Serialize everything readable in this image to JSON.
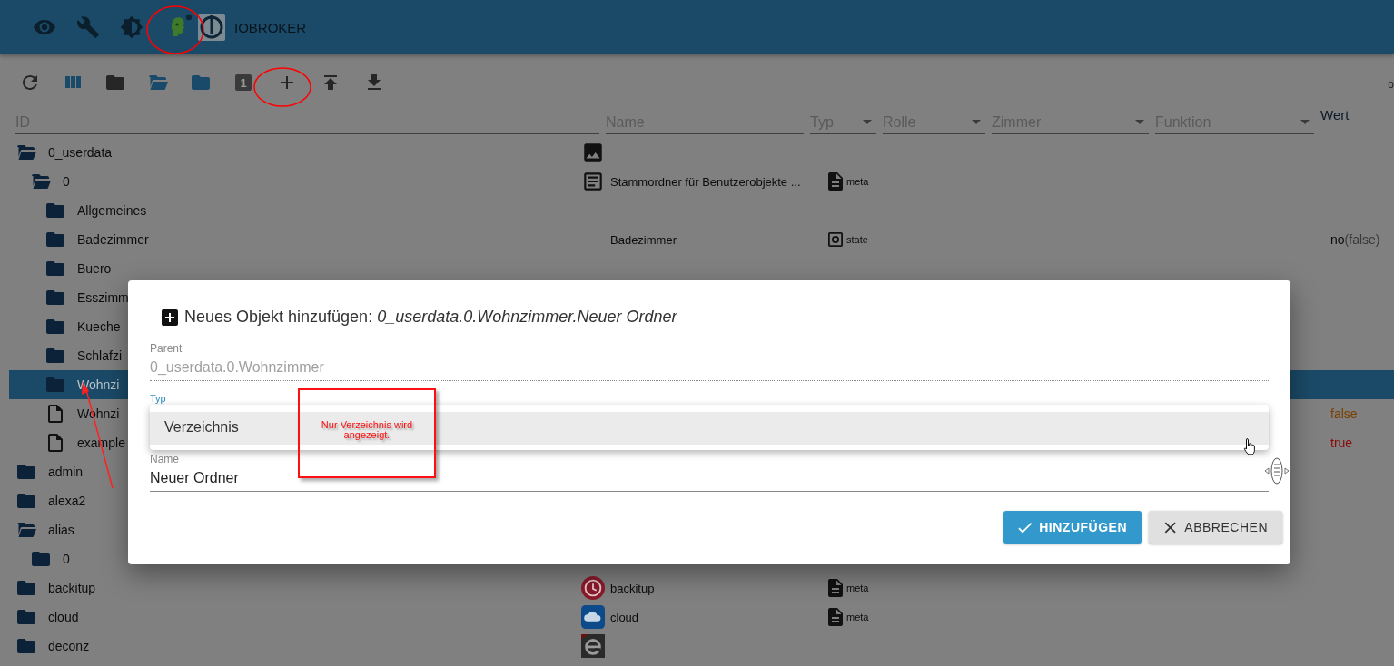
{
  "header": {
    "icons": [
      {
        "kind": "eye"
      },
      {
        "kind": "wrench"
      },
      {
        "kind": "brightness"
      },
      {
        "kind": "head"
      }
    ],
    "brand": "IOBROKER"
  },
  "toolbar": {
    "buttons": [
      {
        "kind": "refresh"
      },
      {
        "kind": "columns"
      },
      {
        "kind": "folder-dark"
      },
      {
        "kind": "folder-open"
      },
      {
        "kind": "folder-blue"
      },
      {
        "kind": "counter",
        "label": "1"
      },
      {
        "kind": "add"
      },
      {
        "kind": "upload"
      },
      {
        "kind": "download"
      }
    ],
    "edge_text": "o"
  },
  "filters": [
    {
      "label": "ID",
      "kind": "text"
    },
    {
      "label": "Name",
      "kind": "text"
    },
    {
      "label": "Typ",
      "kind": "select"
    },
    {
      "label": "Rolle",
      "kind": "select"
    },
    {
      "label": "Zimmer",
      "kind": "select"
    },
    {
      "label": "Funktion",
      "kind": "select"
    },
    {
      "label": "Wert",
      "kind": "heading"
    }
  ],
  "tree": [
    {
      "label": "0_userdata",
      "kind": "open-folder",
      "selected": false,
      "name": {
        "kind": "image"
      },
      "children": [
        {
          "label": "0",
          "kind": "open-folder",
          "selected": false,
          "name": {
            "kind": "article",
            "text": "Stammordner für Benutzerobjekte ..."
          },
          "type": {
            "kind": "meta",
            "text": "meta"
          },
          "children": [
            {
              "label": "Allgemeines",
              "kind": "folder",
              "selected": false
            },
            {
              "label": "Badezimmer",
              "kind": "folder",
              "selected": false,
              "name": {
                "text": "Badezimmer"
              },
              "type": {
                "kind": "state",
                "text": "state"
              },
              "value": {
                "text": "no",
                "raw": "(false)"
              }
            },
            {
              "label": "Buero",
              "kind": "folder",
              "selected": false
            },
            {
              "label": "Esszimm",
              "kind": "folder",
              "selected": false
            },
            {
              "label": "Kueche",
              "kind": "folder",
              "selected": false
            },
            {
              "label": "Schlafzi",
              "kind": "folder",
              "selected": false
            },
            {
              "label": "Wohnzi",
              "kind": "folder",
              "selected": true
            },
            {
              "label": "Wohnzi",
              "kind": "file",
              "selected": false,
              "value": {
                "text": "false",
                "color": "#7a4000"
              }
            },
            {
              "label": "example",
              "kind": "file",
              "selected": false,
              "value": {
                "text": "true",
                "color": "#8a0a0a"
              }
            }
          ]
        }
      ]
    },
    {
      "label": "admin",
      "kind": "folder",
      "selected": false
    },
    {
      "label": "alexa2",
      "kind": "folder",
      "selected": false
    },
    {
      "label": "alias",
      "kind": "open-folder",
      "selected": false,
      "children": [
        {
          "label": "0",
          "kind": "folder",
          "selected": false
        }
      ]
    },
    {
      "label": "backitup",
      "kind": "folder",
      "selected": false,
      "name": {
        "kind": "clock",
        "text": "backitup"
      },
      "type": {
        "kind": "meta",
        "text": "meta"
      }
    },
    {
      "label": "cloud",
      "kind": "folder",
      "selected": false,
      "name": {
        "kind": "cloud",
        "text": "cloud"
      },
      "type": {
        "kind": "meta",
        "text": "meta"
      }
    },
    {
      "label": "deconz",
      "kind": "folder",
      "selected": false,
      "name": {
        "kind": "e-logo"
      }
    }
  ],
  "dialog": {
    "title": "Neues Objekt hinzufügen: *0_userdata.0.Wohnzimmer.Neuer Ordner*",
    "parent_label": "Parent",
    "parent_value": "0_userdata.0.Wohnzimmer",
    "type_label": "Typ",
    "type_options": [
      {
        "label": "Verzeichnis",
        "selected": true
      }
    ],
    "name_label": "Name",
    "name_value": "Neuer Ordner",
    "buttons": [
      {
        "label": "HINZUFÜGEN",
        "kind": "primary"
      },
      {
        "label": "ABBRECHEN",
        "kind": "secondary"
      }
    ]
  },
  "annotation": {
    "note": "Nur Verzeichnis wird angezeigt."
  }
}
